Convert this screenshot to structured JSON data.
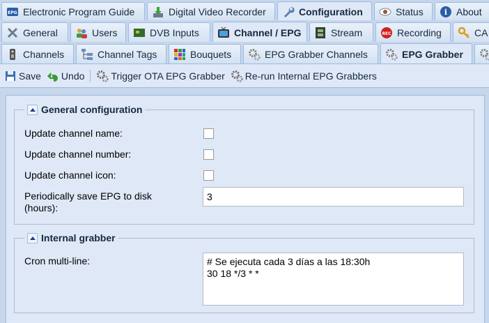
{
  "tabs_main": [
    {
      "label": "Electronic Program Guide",
      "icon": "epg-icon"
    },
    {
      "label": "Digital Video Recorder",
      "icon": "download-icon"
    },
    {
      "label": "Configuration",
      "icon": "wrench-icon",
      "active": true
    },
    {
      "label": "Status",
      "icon": "eye-icon"
    },
    {
      "label": "About",
      "icon": "info-icon"
    }
  ],
  "tabs_config": [
    {
      "label": "General",
      "icon": "tools-icon"
    },
    {
      "label": "Users",
      "icon": "users-icon"
    },
    {
      "label": "DVB Inputs",
      "icon": "card-icon"
    },
    {
      "label": "Channel / EPG",
      "icon": "tv-icon",
      "active": true
    },
    {
      "label": "Stream",
      "icon": "film-icon"
    },
    {
      "label": "Recording",
      "icon": "rec-icon"
    },
    {
      "label": "CA",
      "icon": "key-icon"
    }
  ],
  "tabs_channel": [
    {
      "label": "Channels",
      "icon": "remote-icon"
    },
    {
      "label": "Channel Tags",
      "icon": "tree-icon"
    },
    {
      "label": "Bouquets",
      "icon": "grid-icon"
    },
    {
      "label": "EPG Grabber Channels",
      "icon": "gears-icon"
    },
    {
      "label": "EPG Grabber",
      "icon": "gears-icon",
      "active": true
    }
  ],
  "toolbar": {
    "save": "Save",
    "undo": "Undo",
    "trigger": "Trigger OTA EPG Grabber",
    "rerun": "Re-run Internal EPG Grabbers"
  },
  "general": {
    "legend": "General configuration",
    "update_name": "Update channel name:",
    "update_number": "Update channel number:",
    "update_icon": "Update channel icon:",
    "save_epg": "Periodically save EPG to disk (hours):",
    "save_epg_value": "3"
  },
  "internal": {
    "legend": "Internal grabber",
    "cron_label": "Cron multi-line:",
    "cron_value": "# Se ejecuta cada 3 días a las 18:30h\n30 18 */3 * *"
  },
  "colors": {
    "accent": "#15428b",
    "tab_border": "#99bbe8",
    "panel_bg": "#dfe8f6"
  }
}
